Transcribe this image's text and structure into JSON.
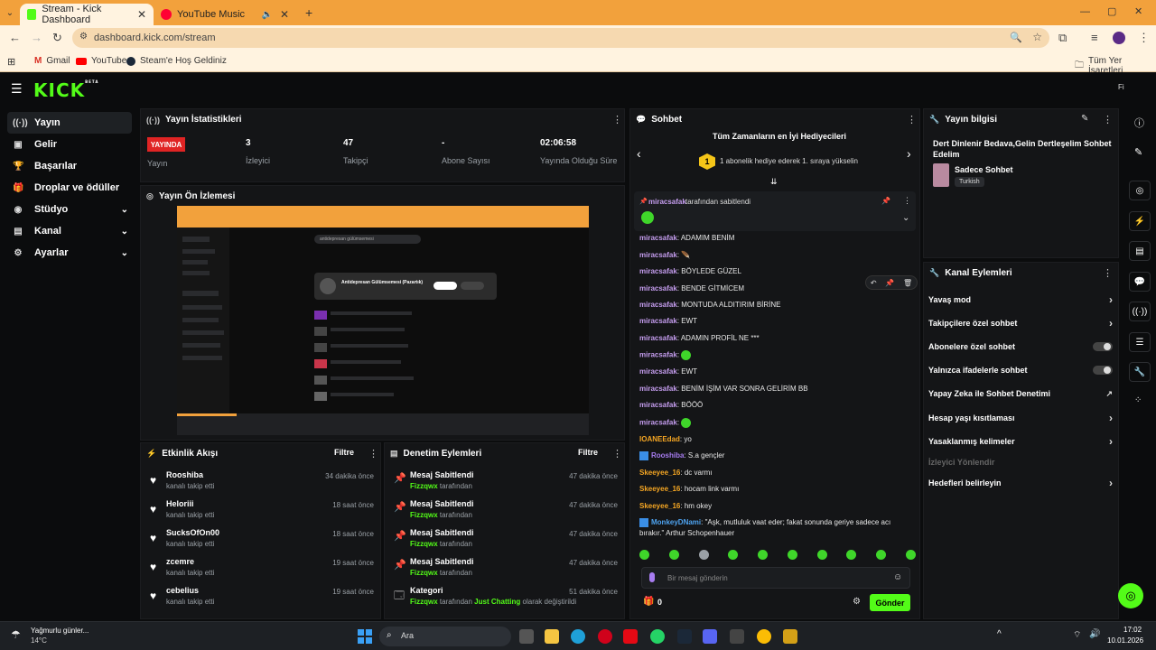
{
  "browser": {
    "tabs": [
      {
        "label": "Stream - Kick Dashboard",
        "active": true
      },
      {
        "label": "YouTube Music",
        "active": false
      }
    ],
    "new_tab_icon": "plus-icon",
    "url": "dashboard.kick.com/stream",
    "bookmarks": [
      "Gmail",
      "YouTube",
      "Steam'e Hoş Geldiniz"
    ],
    "all_bookmarks": "Tüm Yer İşaretleri"
  },
  "app": {
    "logo": "KICK",
    "logo_badge": "BETA",
    "user_initials": "Fi"
  },
  "sidebar": {
    "items": [
      {
        "label": "Yayın",
        "icon": "broadcast-icon",
        "expandable": false,
        "active": true
      },
      {
        "label": "Gelir",
        "icon": "wallet-icon",
        "expandable": false,
        "active": false
      },
      {
        "label": "Başarılar",
        "icon": "trophy-icon",
        "expandable": false,
        "active": false
      },
      {
        "label": "Droplar ve ödüller",
        "icon": "gift-icon",
        "expandable": false,
        "active": false
      },
      {
        "label": "Stüdyo",
        "icon": "studio-icon",
        "expandable": true,
        "active": false
      },
      {
        "label": "Kanal",
        "icon": "channel-icon",
        "expandable": true,
        "active": false
      },
      {
        "label": "Ayarlar",
        "icon": "gear-icon",
        "expandable": true,
        "active": false
      }
    ]
  },
  "stats": {
    "title": "Yayın İstatistikleri",
    "live_badge": "YAYINDA",
    "live_label": "Yayın",
    "items": [
      {
        "value": "3",
        "label": "İzleyici"
      },
      {
        "value": "47",
        "label": "Takipçi"
      },
      {
        "value": "-",
        "label": "Abone Sayısı"
      },
      {
        "value": "02:06:58",
        "label": "Yayında Olduğu Süre"
      }
    ]
  },
  "preview": {
    "title": "Yayın Ön İzlemesi",
    "search_text": "antidepresan gülümsemesi",
    "track_title": "Antidepresan Gülümsemesi (Pazartık)"
  },
  "activity": {
    "title": "Etkinlik Akışı",
    "filter": "Filtre",
    "events": [
      {
        "name": "Rooshiba",
        "sub": "kanalı takip etti",
        "time": "34 dakika önce"
      },
      {
        "name": "Heloriii",
        "sub": "kanalı takip etti",
        "time": "18 saat önce"
      },
      {
        "name": "SucksOfOn00",
        "sub": "kanalı takip etti",
        "time": "18 saat önce"
      },
      {
        "name": "zcemre",
        "sub": "kanalı takip etti",
        "time": "19 saat önce"
      },
      {
        "name": "cebelius",
        "sub": "kanalı takip etti",
        "time": "19 saat önce"
      }
    ]
  },
  "moderation": {
    "title": "Denetim Eylemleri",
    "filter": "Filtre",
    "actions": [
      {
        "name": "Mesaj Sabitlendi",
        "user": "Fizzqwx",
        "sub": "tarafından",
        "time": "47 dakika önce",
        "icon": "pin-icon"
      },
      {
        "name": "Mesaj Sabitlendi",
        "user": "Fizzqwx",
        "sub": "tarafından",
        "time": "47 dakika önce",
        "icon": "pin-icon"
      },
      {
        "name": "Mesaj Sabitlendi",
        "user": "Fizzqwx",
        "sub": "tarafından",
        "time": "47 dakika önce",
        "icon": "pin-icon"
      },
      {
        "name": "Mesaj Sabitlendi",
        "user": "Fizzqwx",
        "sub": "tarafından",
        "time": "47 dakika önce",
        "icon": "pin-icon"
      }
    ],
    "category": {
      "name": "Kategori",
      "user": "Fizzqwx",
      "pre": "tarafından",
      "cat": "Just Chatting",
      "post": "olarak değiştirildi",
      "time": "51 dakika önce"
    }
  },
  "chat": {
    "title": "Sohbet",
    "leaderboard_title": "Tüm Zamanların en İyi Hediyecileri",
    "leaderboard_rank": "1",
    "leaderboard_text": "1 abonelik hediye ederek 1. sıraya yükselin",
    "pinned_by_user": "miracsafak",
    "pinned_by_text": "tarafından sabitlendi",
    "messages": [
      {
        "user": "miracsafak",
        "text": "ADAMIM BENİM",
        "color": "#c69ef0"
      },
      {
        "user": "miracsafak",
        "text": "🪶",
        "color": "#c69ef0"
      },
      {
        "user": "miracsafak",
        "text": "BÖYLEDE GÜZEL",
        "color": "#c69ef0"
      },
      {
        "user": "miracsafak",
        "text": "BENDE GİTMİCEM",
        "color": "#c69ef0"
      },
      {
        "user": "miracsafak",
        "text": "MONTUDA ALDITIRIM BİRİNE",
        "color": "#c69ef0"
      },
      {
        "user": "miracsafak",
        "text": "EWT",
        "color": "#c69ef0"
      },
      {
        "user": "miracsafak",
        "text": "ADAMIN PROFİL NE ***",
        "color": "#c69ef0"
      },
      {
        "user": "miracsafak",
        "text": "",
        "emote": true,
        "color": "#c69ef0"
      },
      {
        "user": "miracsafak",
        "text": "EWT",
        "color": "#c69ef0"
      },
      {
        "user": "miracsafak",
        "text": "BENİM İŞİM VAR SONRA GELİRİM BB",
        "color": "#c69ef0"
      },
      {
        "user": "miracsafak",
        "text": "BÖÖÖ",
        "color": "#c69ef0"
      },
      {
        "user": "miracsafak",
        "text": "",
        "emote": true,
        "color": "#c69ef0"
      },
      {
        "user": "IOANEEdad",
        "text": "yo",
        "color": "#f5a623"
      },
      {
        "user": "Rooshiba",
        "text": "S.a gençler",
        "color": "#a77cf0",
        "badge": true
      },
      {
        "user": "Skeeyee_16",
        "text": "dc varmı",
        "color": "#f5a623"
      },
      {
        "user": "Skeeyee_16",
        "text": "hocam link varmı",
        "color": "#f5a623"
      },
      {
        "user": "Skeeyee_16",
        "text": "hm okey",
        "color": "#f5a623"
      },
      {
        "user": "MonkeyDNami",
        "text": "\"Aşk, mutluluk vaat eder; fakat sonunda geriye sadece acı",
        "color": "#4ea3f0",
        "badge": true
      },
      {
        "user": "",
        "text": "bırakır.\" Arthur Schopenhauer",
        "color": "#4ea3f0"
      }
    ],
    "input_placeholder": "Bir mesaj gönderin",
    "points": "0",
    "send": "Gönder"
  },
  "stream_info": {
    "title": "Yayın bilgisi",
    "stream_title": "Dert Dinlenir Bedava,Gelin Dertleşelim Sohbet Edelim",
    "category": "Sadece Sohbet",
    "language": "Turkish"
  },
  "channel_actions": {
    "title": "Kanal Eylemleri",
    "items": [
      {
        "label": "Yavaş mod",
        "type": "arrow"
      },
      {
        "label": "Takipçilere özel sohbet",
        "type": "arrow"
      },
      {
        "label": "Abonelere özel sohbet",
        "type": "toggle"
      },
      {
        "label": "Yalnızca ifadelerle sohbet",
        "type": "toggle"
      },
      {
        "label": "Yapay Zeka ile Sohbet Denetimi",
        "type": "external"
      },
      {
        "label": "Hesap yaşı kısıtlaması",
        "type": "arrow"
      },
      {
        "label": "Yasaklanmış kelimeler",
        "type": "arrow"
      },
      {
        "label": "İzleyici Yönlendir",
        "type": "disabled"
      },
      {
        "label": "Hedefleri belirleyin",
        "type": "arrow"
      }
    ]
  },
  "taskbar": {
    "weather_title": "Yağmurlu günler...",
    "weather_temp": "14°C",
    "search": "Ara",
    "time": "17:02",
    "date": "10.01.2026"
  }
}
